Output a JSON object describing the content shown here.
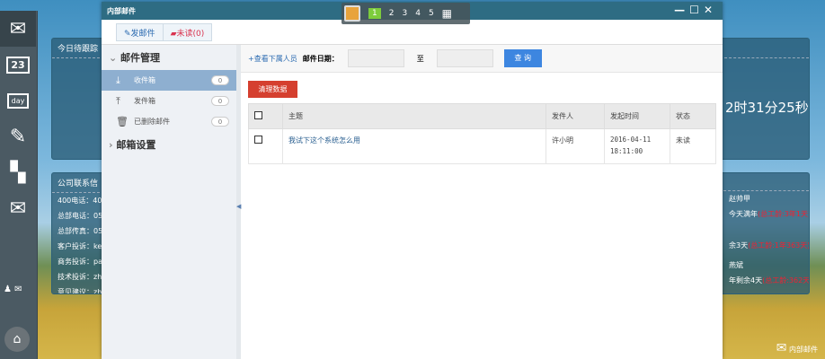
{
  "desktop": {
    "dock": {
      "icons": [
        "mail-icon",
        "calendar-icon",
        "day-icon",
        "edit-note-icon",
        "apps-add-icon",
        "mail-icon"
      ],
      "calendar_day": "23",
      "day_label": "day"
    },
    "tracking_panel": {
      "title": "今日待跟踪"
    },
    "clock_panel": {
      "time": "2时31分25秒"
    },
    "contact_panel": {
      "title": "公司联系信",
      "lines": [
        "400电话：40",
        "总部电话：05",
        "总部传真：05",
        "客户投诉：ke",
        "商务投诉：pa",
        "技术投诉：zh",
        "意见建议：zh"
      ]
    },
    "birthday_panel": {
      "items": [
        {
          "name": "赵帅甲",
          "text": "今天满年",
          "detail": "(总工龄:3年1天)"
        },
        {
          "name": "",
          "text": "余3天",
          "detail": "(总工龄:1年363天)"
        },
        {
          "name": "燕斌",
          "text": "年剩余4天",
          "detail": "(总工龄:362天)"
        }
      ]
    },
    "taskbar": {
      "pages": [
        "1",
        "2",
        "3",
        "4",
        "5"
      ],
      "active": "1"
    },
    "mail_shortcut": "内部邮件"
  },
  "window": {
    "title": "内部邮件",
    "controls": [
      "—",
      "☐",
      "✕"
    ],
    "toolbar": {
      "compose": "发邮件",
      "unread": "未读(0)"
    },
    "sidebar": {
      "mail_management": "邮件管理",
      "items": [
        {
          "label": "收件箱",
          "count": "0"
        },
        {
          "label": "发件箱",
          "count": "0"
        },
        {
          "label": "已删除邮件",
          "count": "0"
        }
      ],
      "mailbox_settings": "邮箱设置"
    },
    "filter": {
      "view_subordinates": "+查看下属人员",
      "date_label": "邮件日期：",
      "to": "至",
      "query": "查 询",
      "date_from": "",
      "date_to": ""
    },
    "clear_button": "清理数据",
    "table": {
      "headers": [
        "主题",
        "发件人",
        "发起时间",
        "状态"
      ],
      "rows": [
        {
          "subject": "我试下这个系统怎么用",
          "sender": "许小明",
          "date": "2016-04-11",
          "time": "18:11:00",
          "status": "未读"
        }
      ]
    }
  }
}
